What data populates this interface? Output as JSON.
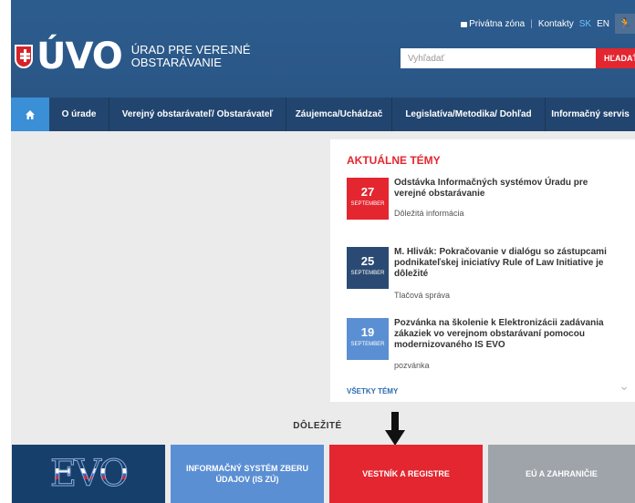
{
  "header": {
    "logo_text": "ÚVO",
    "org_name_line1": "ÚRAD PRE VEREJNÉ",
    "org_name_line2": "OBSTARÁVANIE",
    "private_zone": "Privátna zóna",
    "contacts": "Kontakty",
    "lang_sk": "SK",
    "lang_en": "EN",
    "search_placeholder": "Vyhľadať",
    "search_button": "HĽADAŤ"
  },
  "nav": {
    "items": [
      {
        "label": "O úrade"
      },
      {
        "label": "Verejný obstarávateľ/ Obstarávateľ"
      },
      {
        "label": "Záujemca/Uchádzač"
      },
      {
        "label": "Legislatíva/Metodika/ Dohľad"
      },
      {
        "label": "Informačný servis"
      }
    ]
  },
  "news": {
    "title": "AKTUÁLNE TÉMY",
    "items": [
      {
        "day": "27",
        "month": "SEPTEMBER",
        "headline": "Odstávka Informačných systémov Úradu pre verejné obstarávanie",
        "category": "Dôležitá informácia",
        "color": "#e3262f"
      },
      {
        "day": "25",
        "month": "SEPTEMBER",
        "headline": "M. Hlivák: Pokračovanie v dialógu so zástupcami podnikateľskej iniciatívy Rule of Law Initiative je dôležité",
        "category": "Tlačová správa",
        "color": "#2b4a73"
      },
      {
        "day": "19",
        "month": "SEPTEMBER",
        "headline": "Pozvánka na školenie k Elektronizácii zadávania zákaziek vo verejnom obstarávaní pomocou modernizovaného IS EVO",
        "category": "pozvánka",
        "color": "#5b8fd3"
      }
    ],
    "all_topics": "VŠETKY TÉMY"
  },
  "important": {
    "label": "DÔLEŽITÉ",
    "tiles": [
      {
        "label": "EVO"
      },
      {
        "label": "INFORMAČNÝ SYSTÉM ZBERU ÚDAJOV (IS ZÚ)"
      },
      {
        "label": "VESTNÍK A REGISTRE"
      },
      {
        "label": "EÚ A ZAHRANIČIE"
      }
    ]
  }
}
